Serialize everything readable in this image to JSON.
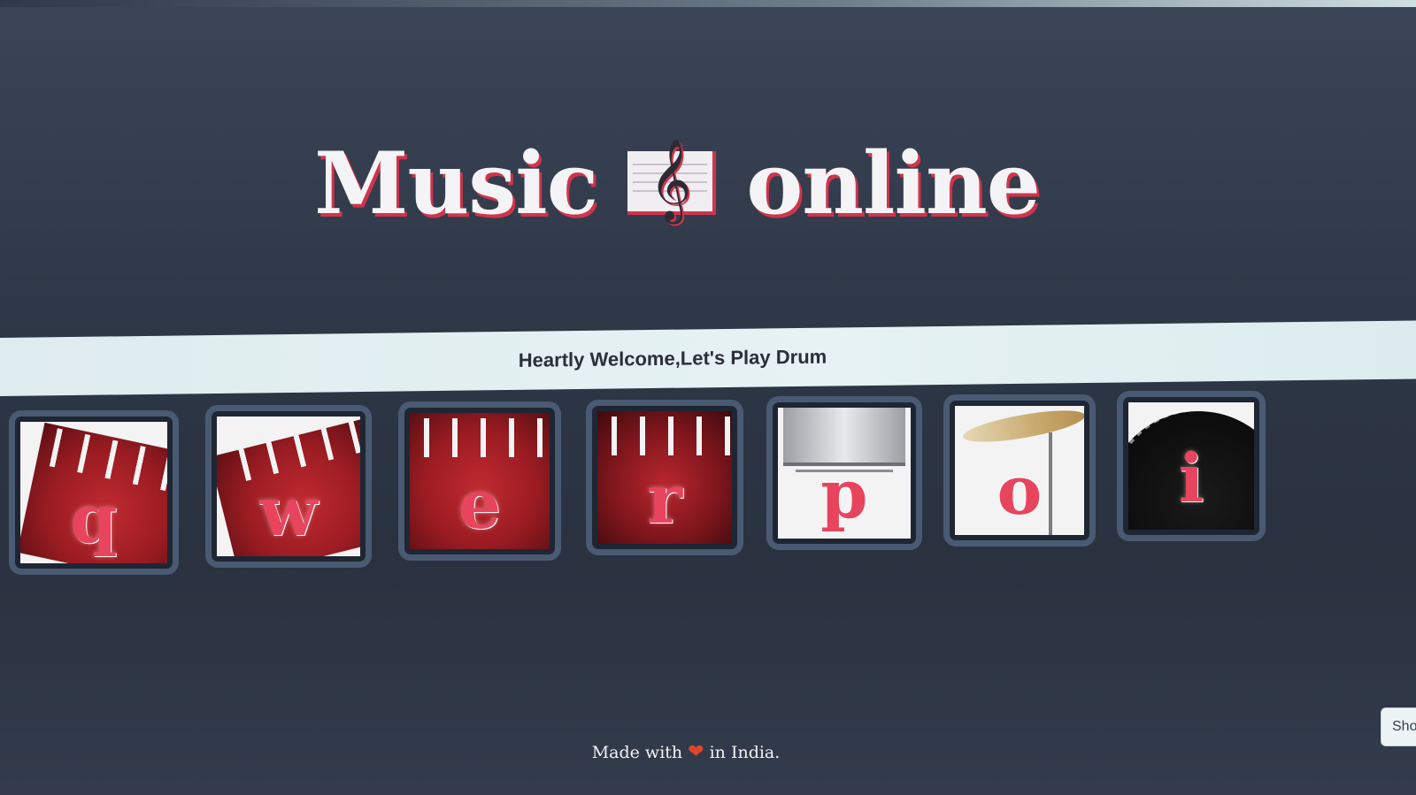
{
  "header": {
    "title_left": "Music",
    "title_right": "online",
    "logo_icon": "treble-clef-icon",
    "clef_glyph": "𝄞"
  },
  "banner": {
    "text": "Heartly Welcome,Let's Play Drum"
  },
  "drums": [
    {
      "key": "q",
      "instrument": "crash-drum"
    },
    {
      "key": "w",
      "instrument": "kick-drum"
    },
    {
      "key": "e",
      "instrument": "tom-1"
    },
    {
      "key": "r",
      "instrument": "tom-2"
    },
    {
      "key": "p",
      "instrument": "snare"
    },
    {
      "key": "o",
      "instrument": "cymbal"
    },
    {
      "key": "i",
      "instrument": "floor-tom"
    }
  ],
  "footer": {
    "made_with": "Made with",
    "heart": "❤",
    "in_india": "in India."
  },
  "corner_button": {
    "label": "Sho"
  },
  "colors": {
    "accent": "#e8445e",
    "title_shadow": "#d0344c",
    "background": "#2d3645",
    "banner": "#e2eff1",
    "tile_border": "#4a5a72"
  }
}
